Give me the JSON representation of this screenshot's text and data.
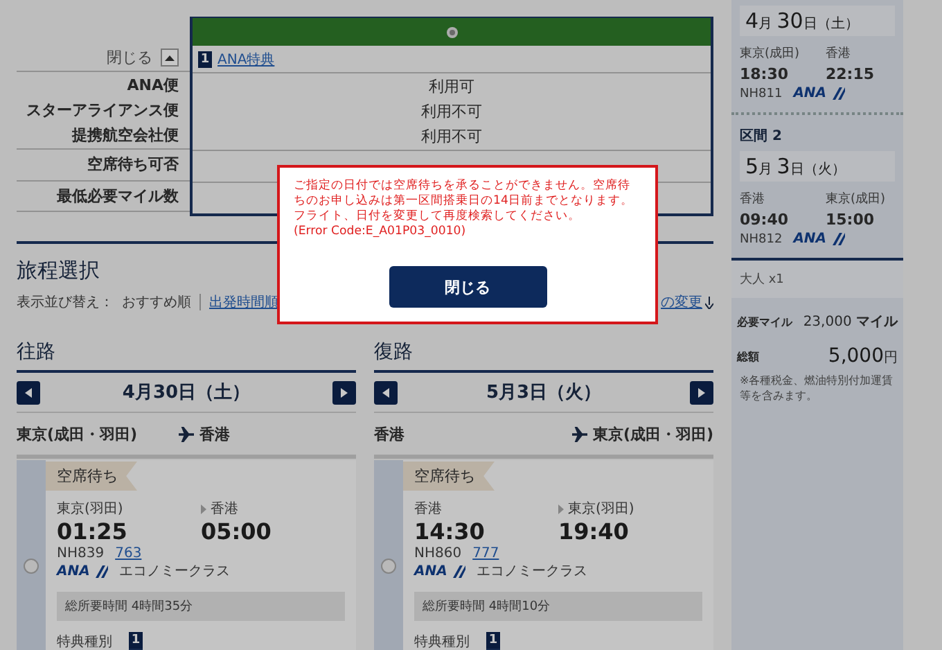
{
  "availability": {
    "toggle": {
      "label": "閉じる",
      "expanded": true
    },
    "award_tab": {
      "badge": "1",
      "label": "ANA特典"
    },
    "groups": [
      [
        {
          "label": "ANA便",
          "value": "利用可"
        },
        {
          "label": "スターアライアンス便",
          "value": "利用不可"
        },
        {
          "label": "提携航空会社便",
          "value": "利用不可"
        }
      ],
      [
        {
          "label": "空席待ち可否"
        }
      ],
      [
        {
          "label": "最低必要マイル数"
        }
      ]
    ]
  },
  "itinerary": {
    "title": "旅程選択",
    "sort_label": "表示並び替え：",
    "sort_options": [
      {
        "label": "おすすめ順",
        "selected": true
      },
      {
        "label": "出発時間順",
        "selected": false
      }
    ],
    "change_link": "の変更"
  },
  "legs": [
    {
      "title": "往路",
      "date": "4月30日（土）",
      "from": "東京(成田・羽田)",
      "to": "香港",
      "flights": [
        {
          "status": "空席待ち",
          "dep_airport": "東京(羽田)",
          "arr_airport": "香港",
          "dep": "01:25",
          "arr": "05:00",
          "flight": "NH839",
          "aircraft": "763",
          "airline": "ANA",
          "cabin": "エコノミークラス",
          "duration": "総所要時間 4時間35分",
          "award_label": "特典種別",
          "award_badge": "1",
          "selected": false
        }
      ]
    },
    {
      "title": "復路",
      "date": "5月3日（火）",
      "from": "香港",
      "to": "東京(成田・羽田)",
      "flights": [
        {
          "status": "空席待ち",
          "dep_airport": "香港",
          "arr_airport": "東京(羽田)",
          "dep": "14:30",
          "arr": "19:40",
          "flight": "NH860",
          "aircraft": "777",
          "airline": "ANA",
          "cabin": "エコノミークラス",
          "duration": "総所要時間 4時間10分",
          "award_label": "特典種別",
          "award_badge": "1",
          "selected": false
        }
      ]
    }
  ],
  "summary": {
    "segments": [
      {
        "date_month": "4",
        "month_unit": "月",
        "date_day": "30",
        "day_unit": "日",
        "weekday": "（土）",
        "dep_airport": "東京(成田)",
        "arr_airport": "香港",
        "dep": "18:30",
        "arr": "22:15",
        "flight": "NH811",
        "airline": "ANA"
      },
      {
        "title": "区間 2",
        "date_month": "5",
        "month_unit": "月",
        "date_day": "3",
        "day_unit": "日",
        "weekday": "（火）",
        "dep_airport": "香港",
        "arr_airport": "東京(成田)",
        "dep": "09:40",
        "arr": "15:00",
        "flight": "NH812",
        "airline": "ANA"
      }
    ],
    "passengers": "大人 x1",
    "miles_label": "必要マイル",
    "miles": "23,000",
    "miles_unit": "マイル",
    "total_label": "総額",
    "total": "5,000",
    "currency": "円",
    "note": "※各種税金、燃油特別付加運賃等を含みます。"
  },
  "dialog": {
    "message": "ご指定の日付では空席待ちを承ることができません。空席待ちのお申し込みは第一区間搭乗日の14日前までとなります。フライト、日付を変更して再度検索してください。",
    "error_code": "(Error Code:E_A01P03_0010)",
    "button": "閉じる"
  }
}
